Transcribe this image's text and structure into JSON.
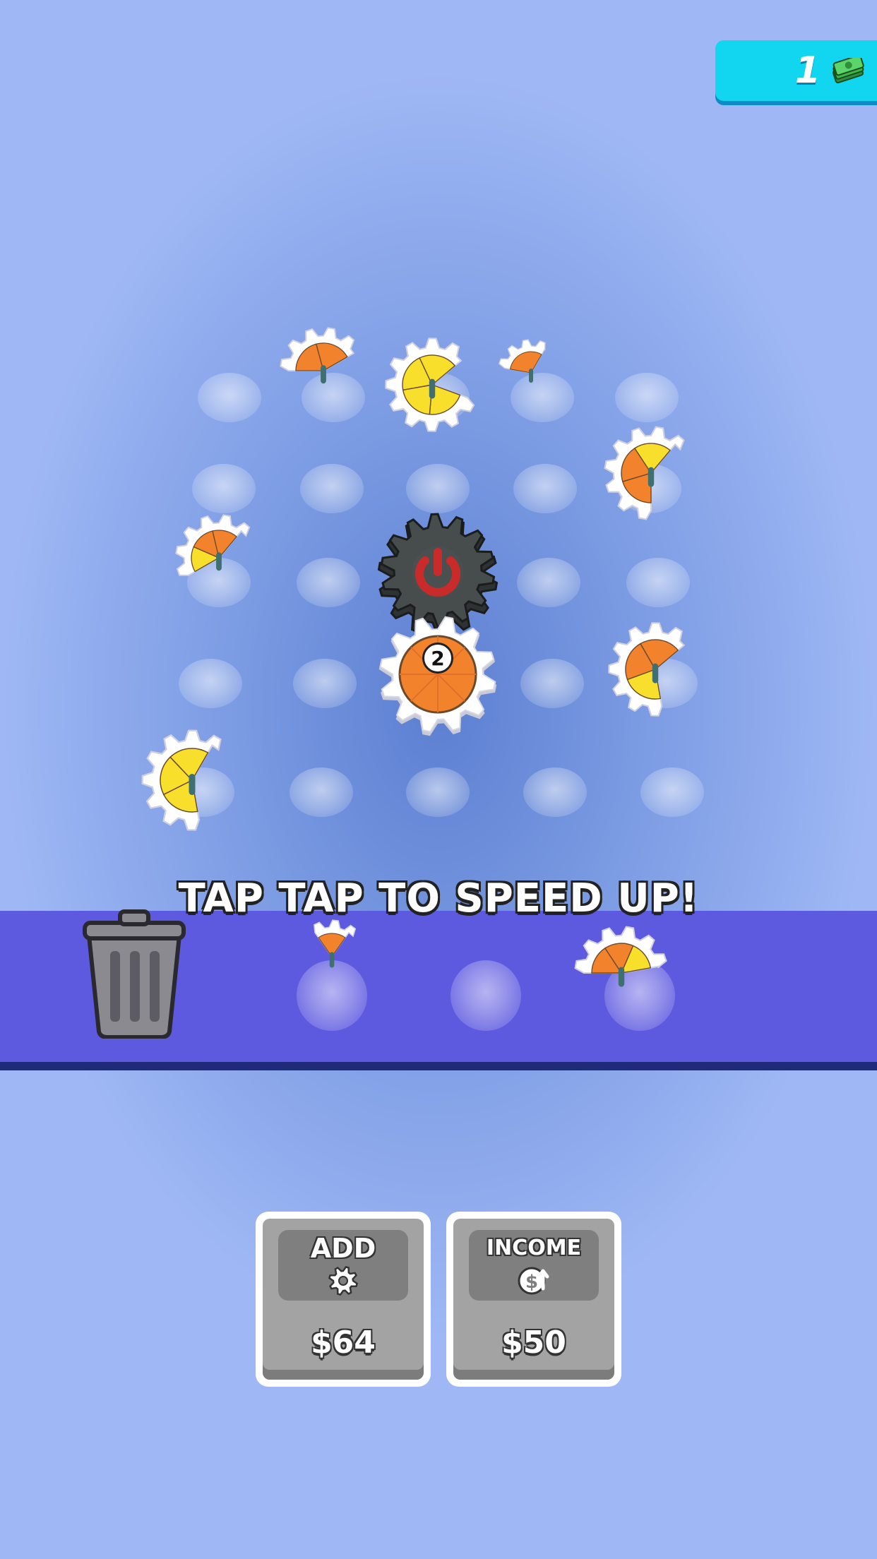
{
  "currency": {
    "value": "1",
    "icon": "cash-stack-icon"
  },
  "board": {
    "center_gear": {
      "level": "2",
      "icon": "power-gear-icon"
    }
  },
  "instruction": "TAP TAP TO SPEED UP!",
  "trash": {
    "icon": "trash-can-icon"
  },
  "shop": {
    "add": {
      "title": "ADD",
      "icon": "gear-icon",
      "price": "$64"
    },
    "income": {
      "title": "INCOME",
      "icon": "dollar-up-icon",
      "price": "$50"
    }
  },
  "colors": {
    "orange": "#f2822b",
    "yellow": "#f7df2c",
    "conveyor": "#5e5ae0",
    "currency_bg": "#12d6f0"
  }
}
